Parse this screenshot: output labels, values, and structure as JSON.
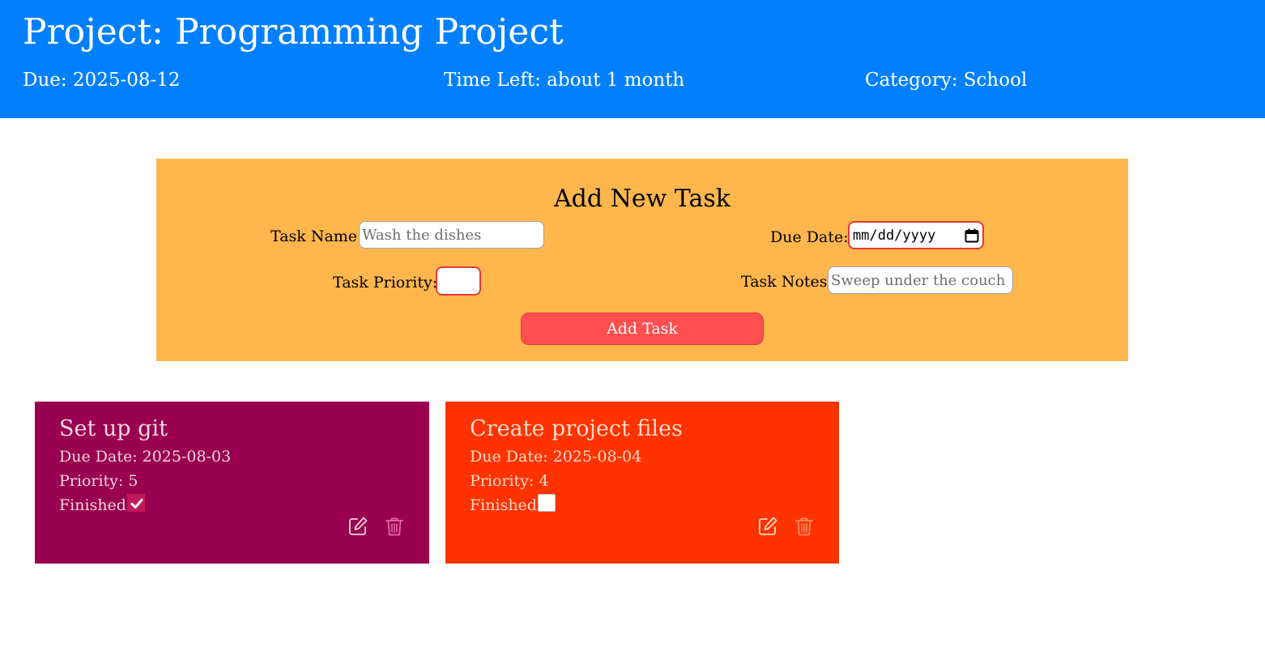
{
  "header": {
    "title": "Project: Programming Project",
    "due": "Due: 2025-08-12",
    "time_left": "Time Left: about 1 month",
    "category": "Category: School"
  },
  "form": {
    "title": "Add New Task",
    "task_name_label": "Task Name:",
    "task_name_placeholder": "Wash the dishes",
    "due_date_label": "Due Date:",
    "due_date_placeholder": "mm/dd/yyyy",
    "priority_label": "Task Priority:",
    "priority_value": "",
    "notes_label": "Task Notes:",
    "notes_placeholder": "Sweep under the couch",
    "submit_label": "Add Task"
  },
  "tasks": [
    {
      "title": "Set up git",
      "due": "Due Date: 2025-08-03",
      "priority": "Priority: 5",
      "finished_label": "Finished",
      "finished": true,
      "color": "#990050",
      "icons": [
        "edit-icon",
        "trash-icon"
      ]
    },
    {
      "title": "Create project files",
      "due": "Due Date: 2025-08-04",
      "priority": "Priority: 4",
      "finished_label": "Finished",
      "finished": false,
      "color": "#ff3300",
      "icons": [
        "edit-icon",
        "trash-icon"
      ]
    }
  ],
  "colors": {
    "header": "#0080ff",
    "form_panel": "#ffb74d",
    "button": "#ff4f4f"
  }
}
